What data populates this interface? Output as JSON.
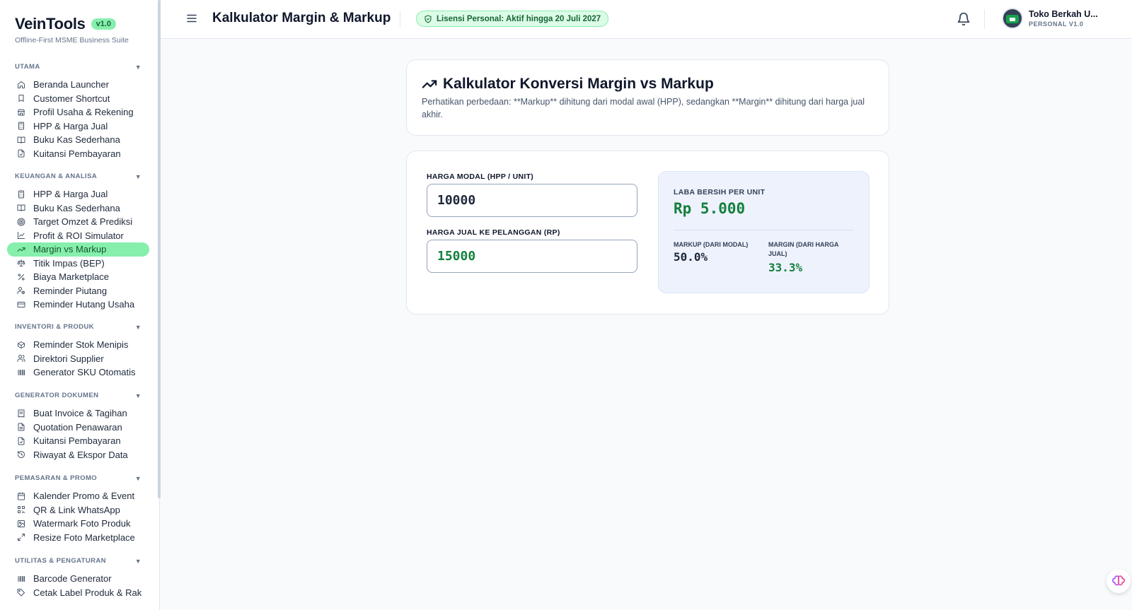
{
  "brand": {
    "name": "VeinTools",
    "version": "v1.0",
    "subtitle": "Offline-First MSME Business Suite"
  },
  "sidebar": {
    "sections": [
      {
        "title": "UTAMA",
        "items": [
          {
            "label": "Beranda Launcher",
            "icon": "home-icon"
          },
          {
            "label": "Customer Shortcut",
            "icon": "bookmark-icon"
          },
          {
            "label": "Profil Usaha & Rekening",
            "icon": "store-icon"
          },
          {
            "label": "HPP & Harga Jual",
            "icon": "calculator-icon"
          },
          {
            "label": "Buku Kas Sederhana",
            "icon": "book-icon"
          },
          {
            "label": "Kuitansi Pembayaran",
            "icon": "file-icon"
          }
        ]
      },
      {
        "title": "KEUANGAN & ANALISA",
        "items": [
          {
            "label": "HPP & Harga Jual",
            "icon": "calculator-icon"
          },
          {
            "label": "Buku Kas Sederhana",
            "icon": "book-icon"
          },
          {
            "label": "Target Omzet & Prediksi",
            "icon": "target-icon"
          },
          {
            "label": "Profit & ROI Simulator",
            "icon": "line-chart-icon"
          },
          {
            "label": "Margin vs Markup",
            "icon": "trending-up-icon",
            "active": true
          },
          {
            "label": "Titik Impas (BEP)",
            "icon": "scale-icon"
          },
          {
            "label": "Biaya Marketplace",
            "icon": "percent-icon"
          },
          {
            "label": "Reminder Piutang",
            "icon": "user-clock-icon"
          },
          {
            "label": "Reminder Hutang Usaha",
            "icon": "credit-card-icon"
          }
        ]
      },
      {
        "title": "INVENTORI & PRODUK",
        "items": [
          {
            "label": "Reminder Stok Menipis",
            "icon": "package-icon"
          },
          {
            "label": "Direktori Supplier",
            "icon": "users-icon"
          },
          {
            "label": "Generator SKU Otomatis",
            "icon": "barcode-icon"
          }
        ]
      },
      {
        "title": "GENERATOR DOKUMEN",
        "items": [
          {
            "label": "Buat Invoice & Tagihan",
            "icon": "receipt-icon"
          },
          {
            "label": "Quotation Penawaran",
            "icon": "file-text-icon"
          },
          {
            "label": "Kuitansi Pembayaran",
            "icon": "file-icon"
          },
          {
            "label": "Riwayat & Ekspor Data",
            "icon": "history-icon"
          }
        ]
      },
      {
        "title": "PEMASARAN & PROMO",
        "items": [
          {
            "label": "Kalender Promo & Event",
            "icon": "calendar-icon"
          },
          {
            "label": "QR & Link WhatsApp",
            "icon": "qr-icon"
          },
          {
            "label": "Watermark Foto Produk",
            "icon": "image-icon"
          },
          {
            "label": "Resize Foto Marketplace",
            "icon": "resize-icon"
          }
        ]
      },
      {
        "title": "UTILITAS & PENGATURAN",
        "items": [
          {
            "label": "Barcode Generator",
            "icon": "barcode-icon"
          },
          {
            "label": "Cetak Label Produk & Rak",
            "icon": "tag-icon"
          }
        ]
      }
    ]
  },
  "header": {
    "title": "Kalkulator Margin & Markup",
    "license": "Lisensi Personal: Aktif hingga 20 Juli 2027",
    "user_name": "Toko Berkah U...",
    "user_role": "PERSONAL V1.0"
  },
  "intro": {
    "title": "Kalkulator Konversi Margin vs Markup",
    "description": "Perhatikan perbedaan: **Markup** dihitung dari modal awal (HPP), sedangkan **Margin** dihitung dari harga jual akhir."
  },
  "calculator": {
    "cost_label": "HARGA MODAL (HPP / UNIT)",
    "cost_value": "10000",
    "price_label": "HARGA JUAL KE PELANGGAN (RP)",
    "price_value": "15000",
    "profit_label": "LABA BERSIH PER UNIT",
    "profit_value": "Rp 5.000",
    "markup_label": "MARKUP (DARI MODAL)",
    "markup_value": "50.0%",
    "margin_label": "MARGIN (DARI HARGA JUAL)",
    "margin_value": "33.3%"
  },
  "colors": {
    "accent": "#86efac",
    "profit": "#15803d",
    "markup": "#1e293b"
  }
}
